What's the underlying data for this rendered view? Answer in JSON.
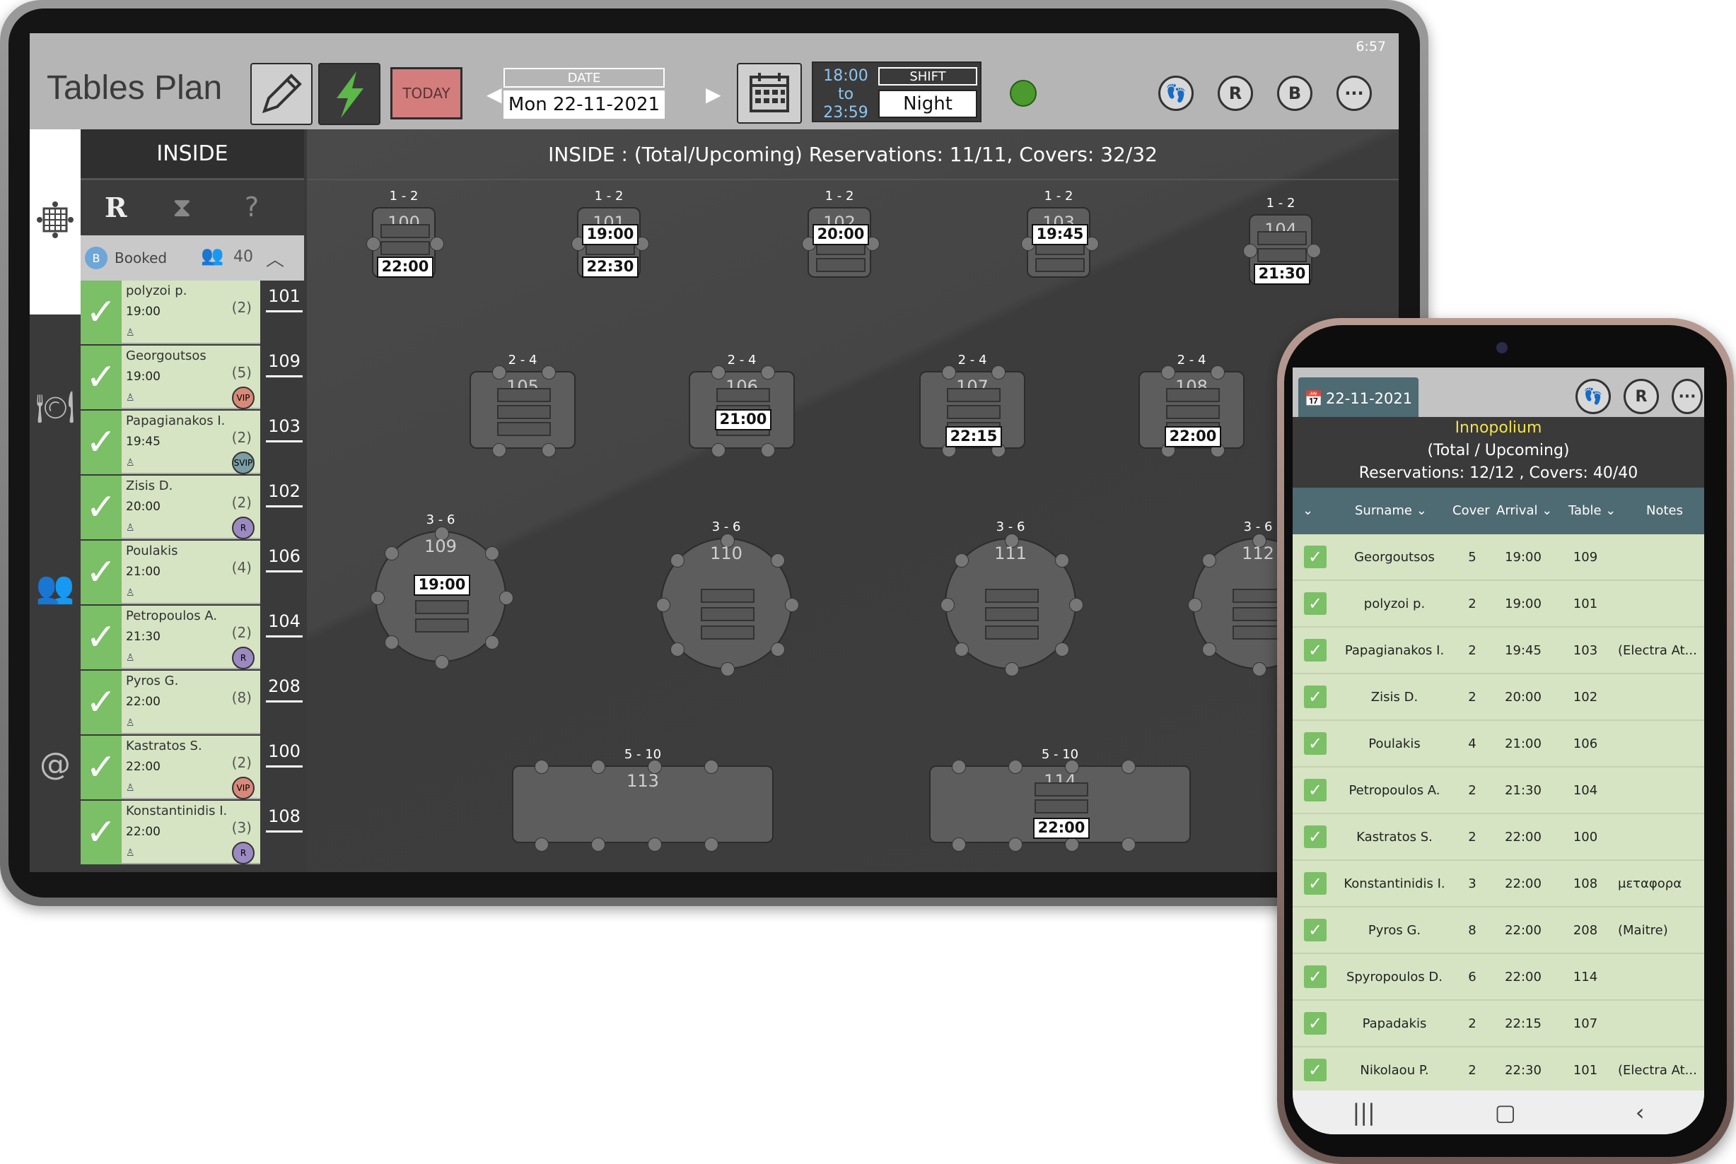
{
  "tablet": {
    "clock": "6:57",
    "title": "Tables Plan",
    "today_label": "TODAY",
    "date_label": "DATE",
    "date_value": "Mon 22-11-2021",
    "shift_time": [
      "18:00",
      "to",
      "23:59"
    ],
    "shift_label": "SHIFT",
    "shift_value": "Night",
    "status_color": "#4a9a2e"
  },
  "sidebar": {
    "area_tab": "INSIDE",
    "tab_r": "R",
    "tab_q": "?",
    "booked_badge": "B",
    "booked_label": "Booked",
    "booked_count": "40",
    "reservations": [
      {
        "name": "polyzoi p.",
        "time": "19:00",
        "covers": "(2)",
        "table": "101",
        "badge": ""
      },
      {
        "name": "Georgoutsos",
        "time": "19:00",
        "covers": "(5)",
        "table": "109",
        "badge": "VIP"
      },
      {
        "name": "Papagianakos I.",
        "time": "19:45",
        "covers": "(2)",
        "table": "103",
        "badge": "SVIP"
      },
      {
        "name": "Zisis D.",
        "time": "20:00",
        "covers": "(2)",
        "table": "102",
        "badge": "R"
      },
      {
        "name": "Poulakis",
        "time": "21:00",
        "covers": "(4)",
        "table": "106",
        "badge": ""
      },
      {
        "name": "Petropoulos A.",
        "time": "21:30",
        "covers": "(2)",
        "table": "104",
        "badge": "R"
      },
      {
        "name": "Pyros G.",
        "time": "22:00",
        "covers": "(8)",
        "table": "208",
        "badge": ""
      },
      {
        "name": "Kastratos S.",
        "time": "22:00",
        "covers": "(2)",
        "table": "100",
        "badge": "VIP"
      },
      {
        "name": "Konstantinidis I.",
        "time": "22:00",
        "covers": "(3)",
        "table": "108",
        "badge": "R"
      }
    ]
  },
  "floor": {
    "header": "INSIDE : (Total/Upcoming) Reservations: 11/11, Covers: 32/32",
    "tables": [
      {
        "id": "100",
        "cap": "1 - 2",
        "time": "22:00"
      },
      {
        "id": "101",
        "cap": "1 - 2",
        "time": "19:00",
        "time2": "22:30"
      },
      {
        "id": "102",
        "cap": "1 - 2",
        "time": "20:00"
      },
      {
        "id": "103",
        "cap": "1 - 2",
        "time": "19:45"
      },
      {
        "id": "104",
        "cap": "1 - 2",
        "time": "21:30"
      },
      {
        "id": "105",
        "cap": "2 - 4",
        "time": ""
      },
      {
        "id": "106",
        "cap": "2 - 4",
        "time": "21:00"
      },
      {
        "id": "107",
        "cap": "2 - 4",
        "time": "22:15"
      },
      {
        "id": "108",
        "cap": "2 - 4",
        "time": "22:00"
      },
      {
        "id": "109",
        "cap": "3 - 6",
        "time": "19:00"
      },
      {
        "id": "110",
        "cap": "3 - 6",
        "time": ""
      },
      {
        "id": "111",
        "cap": "3 - 6",
        "time": ""
      },
      {
        "id": "112",
        "cap": "3 - 6",
        "time": ""
      },
      {
        "id": "113",
        "cap": "5 - 10",
        "time": ""
      },
      {
        "id": "114",
        "cap": "5 - 10",
        "time": "22:00"
      }
    ]
  },
  "phone": {
    "date": "22-11-2021",
    "venue": "Innopolium",
    "subtitle": "(Total / Upcoming)",
    "summary": "Reservations: 12/12 , Covers: 40/40",
    "columns": [
      "Surname",
      "Cover",
      "Arrival",
      "Table",
      "Notes"
    ],
    "rows": [
      {
        "surname": "Georgoutsos",
        "cover": "5",
        "arrival": "19:00",
        "table": "109",
        "notes": ""
      },
      {
        "surname": "polyzoi p.",
        "cover": "2",
        "arrival": "19:00",
        "table": "101",
        "notes": ""
      },
      {
        "surname": "Papagianakos I.",
        "cover": "2",
        "arrival": "19:45",
        "table": "103",
        "notes": "(Electra At..."
      },
      {
        "surname": "Zisis D.",
        "cover": "2",
        "arrival": "20:00",
        "table": "102",
        "notes": ""
      },
      {
        "surname": "Poulakis",
        "cover": "4",
        "arrival": "21:00",
        "table": "106",
        "notes": ""
      },
      {
        "surname": "Petropoulos A.",
        "cover": "2",
        "arrival": "21:30",
        "table": "104",
        "notes": ""
      },
      {
        "surname": "Kastratos S.",
        "cover": "2",
        "arrival": "22:00",
        "table": "100",
        "notes": ""
      },
      {
        "surname": "Konstantinidis I.",
        "cover": "3",
        "arrival": "22:00",
        "table": "108",
        "notes": "μεταφορα"
      },
      {
        "surname": "Pyros G.",
        "cover": "8",
        "arrival": "22:00",
        "table": "208",
        "notes": "(Maitre)"
      },
      {
        "surname": "Spyropoulos D.",
        "cover": "6",
        "arrival": "22:00",
        "table": "114",
        "notes": ""
      },
      {
        "surname": "Papadakis",
        "cover": "2",
        "arrival": "22:15",
        "table": "107",
        "notes": ""
      },
      {
        "surname": "Nikolaou P.",
        "cover": "2",
        "arrival": "22:30",
        "table": "101",
        "notes": "(Electra At..."
      }
    ]
  }
}
